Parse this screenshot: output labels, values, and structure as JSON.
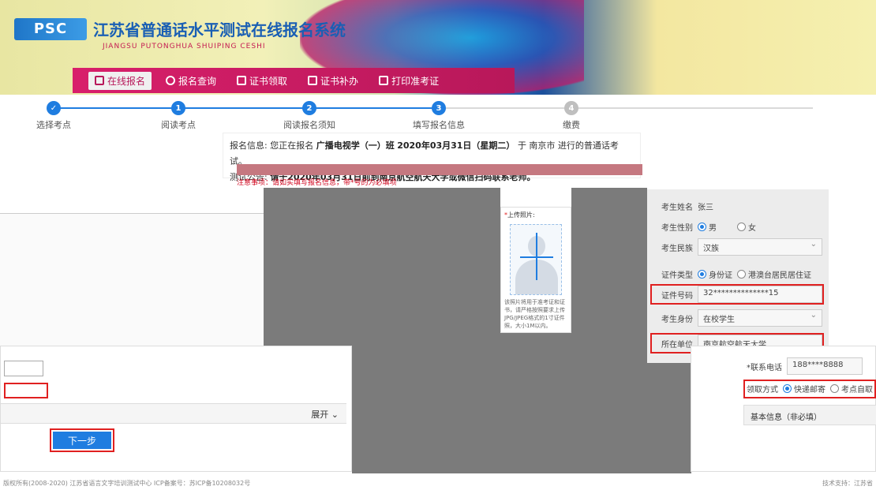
{
  "header": {
    "logo_mark": "PSC",
    "title": "江苏省普通话水平测试在线报名系统",
    "subtitle": "JIANGSU PUTONGHUA SHUIPING CESHI"
  },
  "nav": {
    "items": [
      {
        "label": "在线报名",
        "icon": "edit-icon",
        "active": true
      },
      {
        "label": "报名查询",
        "icon": "search-icon",
        "active": false
      },
      {
        "label": "证书领取",
        "icon": "certificate-icon",
        "active": false
      },
      {
        "label": "证书补办",
        "icon": "document-icon",
        "active": false
      },
      {
        "label": "打印准考证",
        "icon": "print-icon",
        "active": false
      }
    ]
  },
  "steps": [
    {
      "num": "",
      "label": "选择考点",
      "state": "done"
    },
    {
      "num": "1",
      "label": "阅读考点",
      "state": "done"
    },
    {
      "num": "2",
      "label": "阅读报名须知",
      "state": "done"
    },
    {
      "num": "3",
      "label": "填写报名信息",
      "state": "current"
    },
    {
      "num": "4",
      "label": "缴费",
      "state": "pending"
    }
  ],
  "info": {
    "line1_prefix": "报名信息: 您正在报名",
    "line1_org": "广播电视学（一）班",
    "line1_date": "2020年03月31日（星期二）",
    "line1_suffix": "于 南京市 进行的普通话考试。",
    "line2_prefix": "测试公告:",
    "line2_text": "请于2020年03月31日前到南京航空航天大学或微信扫码联系老师。"
  },
  "warning": "注意事项：请如实填写报名信息，带*号的为必填项",
  "photo": {
    "label_req": "*",
    "label": "上传照片:",
    "note": "该照片将用于准考证和证书，请严格按照要求上传JPG/JPEG格式的1寸证件照，大小1M以内。"
  },
  "form": {
    "name_label": "考生姓名",
    "name_value": "张三",
    "gender_label": "考生性别",
    "gender_options": [
      "男",
      "女"
    ],
    "gender_selected": "男",
    "nation_label": "考生民族",
    "nation_value": "汉族",
    "id_type_label": "证件类型",
    "id_type_options": [
      "身份证",
      "港澳台居民居住证"
    ],
    "id_type_selected": "身份证",
    "id_label": "证件号码",
    "id_value": "32**************15",
    "identity_label": "考生身份",
    "identity_value": "在校学生",
    "school_label": "所在单位",
    "school_value": "南京航空航天大学"
  },
  "right_lower": {
    "phone_label": "*联系电话",
    "phone_value": "188****8888",
    "mail_label": "领取方式",
    "mail_options": [
      "快递邮寄",
      "考点自取"
    ],
    "mail_selected": "快递邮寄",
    "basic_info": "基本信息（非必填）"
  },
  "left_lower": {
    "expand_label": "展开 ⌄",
    "next_label": "下一步"
  },
  "footer": {
    "left": "版权所有(2008-2020) 江苏省语言文字培训测试中心 ICP备案号：苏ICP备10208032号",
    "right": "技术支持：江苏省"
  }
}
